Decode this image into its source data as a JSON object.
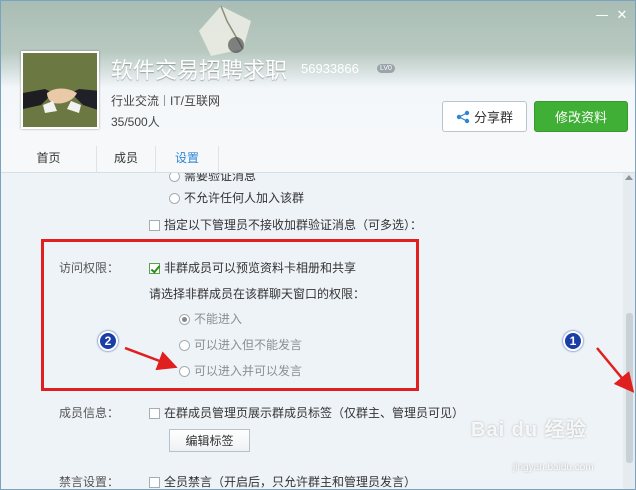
{
  "header": {
    "group_name": "软件交易招聘求职",
    "group_id": "56933866",
    "level": "LV0",
    "category": "行业交流",
    "subcategory": "IT/互联网",
    "members": "35/500人",
    "share_label": "分享群",
    "edit_label": "修改资料",
    "window_controls": [
      "minimize-icon",
      "close-icon"
    ]
  },
  "tabs": [
    {
      "label": "首页"
    },
    {
      "label": "成员"
    },
    {
      "label": "设置",
      "active": true
    }
  ],
  "settings": {
    "partial_option": "需要验证消息",
    "no_join_option": "不允许任何人加入该群",
    "admin_exclude_option": "指定以下管理员不接收加群验证消息（可多选）：",
    "access_label": "访问权限：",
    "preview_option": "非群成员可以预览资料卡相册和共享",
    "chat_permission_prompt": "请选择非群成员在该群聊天窗口的权限：",
    "chat_options": [
      {
        "label": "不能进入",
        "selected": true
      },
      {
        "label": "可以进入但不能发言",
        "selected": false
      },
      {
        "label": "可以进入并可以发言",
        "selected": false
      }
    ],
    "member_info_label": "成员信息：",
    "member_tag_option": "在群成员管理页展示群成员标签（仅群主、管理员可见）",
    "edit_tag_label": "编辑标签",
    "mute_label": "禁言设置：",
    "mute_option": "全员禁言（开启后，只允许群主和管理员发言）"
  },
  "annotations": {
    "badge_1": "1",
    "badge_2": "2",
    "watermark": "Bai du 经验",
    "watermark_sub": "jingyan.baidu.com",
    "highlight_color": "#e0201f",
    "arrow_color": "#e0201f",
    "badge_color": "#1a3ea8"
  },
  "colors": {
    "accent_green": "#3fb035",
    "tab_active": "#2f86d4"
  }
}
